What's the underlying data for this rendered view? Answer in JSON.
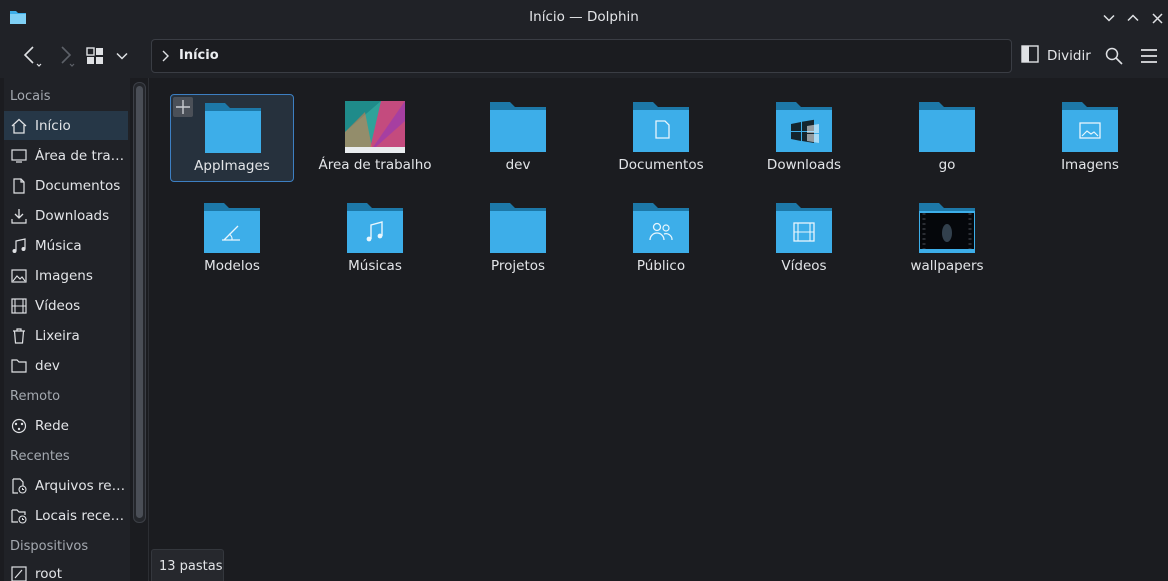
{
  "window": {
    "title": "Início — Dolphin"
  },
  "toolbar": {
    "breadcrumb": "Início",
    "split_label": "Dividir"
  },
  "sidebar": {
    "sections": {
      "places": "Locais",
      "remote": "Remoto",
      "recent": "Recentes",
      "devices": "Dispositivos"
    },
    "places": [
      {
        "label": "Início",
        "icon": "home-icon"
      },
      {
        "label": "Área de trab…",
        "icon": "desktop-icon"
      },
      {
        "label": "Documentos",
        "icon": "document-icon"
      },
      {
        "label": "Downloads",
        "icon": "download-icon"
      },
      {
        "label": "Música",
        "icon": "music-icon"
      },
      {
        "label": "Imagens",
        "icon": "image-icon"
      },
      {
        "label": "Vídeos",
        "icon": "video-icon"
      },
      {
        "label": "Lixeira",
        "icon": "trash-icon"
      },
      {
        "label": "dev",
        "icon": "folder-icon"
      }
    ],
    "remote": [
      {
        "label": "Rede",
        "icon": "network-icon"
      }
    ],
    "recent": [
      {
        "label": "Arquivos rec…",
        "icon": "recent-files-icon"
      },
      {
        "label": "Locais recen…",
        "icon": "recent-locations-icon"
      }
    ],
    "devices": [
      {
        "label": "root",
        "icon": "drive-icon"
      }
    ]
  },
  "folders": [
    {
      "label": "AppImages",
      "emblem": "none",
      "selected": true
    },
    {
      "label": "Área de trabalho",
      "emblem": "wallpaper-thumbnail"
    },
    {
      "label": "dev",
      "emblem": "none"
    },
    {
      "label": "Documentos",
      "emblem": "document"
    },
    {
      "label": "Downloads",
      "emblem": "windows-logo-thumbnail"
    },
    {
      "label": "go",
      "emblem": "none"
    },
    {
      "label": "Imagens",
      "emblem": "image"
    },
    {
      "label": "Modelos",
      "emblem": "template"
    },
    {
      "label": "Músicas",
      "emblem": "music"
    },
    {
      "label": "Projetos",
      "emblem": "none"
    },
    {
      "label": "Público",
      "emblem": "people"
    },
    {
      "label": "Vídeos",
      "emblem": "video"
    },
    {
      "label": "wallpapers",
      "emblem": "dark-thumbnail"
    }
  ],
  "status": {
    "text": "13 pastas"
  },
  "colors": {
    "accent": "#3d7fc2",
    "folder": "#3daee9",
    "folder_tab": "#1d78a8",
    "background": "#1b1c20",
    "panel": "#202227"
  }
}
